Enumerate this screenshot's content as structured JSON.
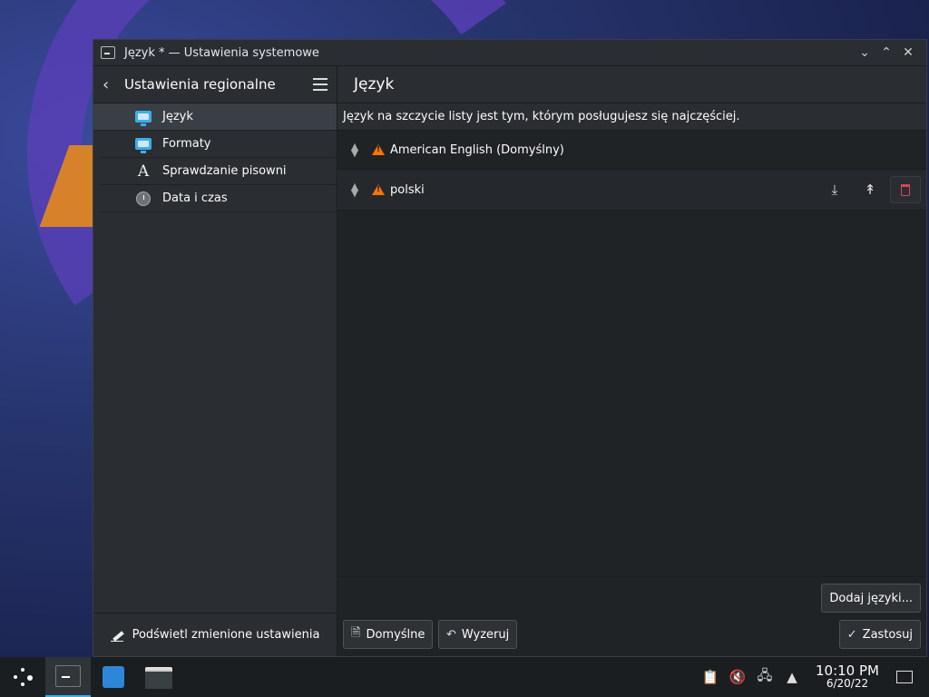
{
  "window": {
    "title": "Język * — Ustawienia systemowe",
    "controls": [
      "minimize",
      "maximize",
      "close"
    ]
  },
  "sidebar": {
    "title": "Ustawienia regionalne",
    "items": [
      {
        "label": "Język",
        "icon": "monitor-flag-icon",
        "active": true
      },
      {
        "label": "Formaty",
        "icon": "monitor-flag-icon",
        "active": false
      },
      {
        "label": "Sprawdzanie pisowni",
        "icon": "letter-a-icon",
        "active": false
      },
      {
        "label": "Data i czas",
        "icon": "clock-icon",
        "active": false
      }
    ],
    "footer_label": "Podświetl zmienione ustawienia"
  },
  "main": {
    "title": "Język",
    "description": "Język na szczycie listy jest tym, którym posługujesz się najczęściej.",
    "languages": [
      {
        "name": "American English (Domyślny)"
      },
      {
        "name": "polski"
      }
    ],
    "buttons": {
      "add": "Dodaj języki...",
      "defaults": "Domyślne",
      "reset": "Wyzeruj",
      "apply": "Zastosuj"
    }
  },
  "taskbar": {
    "time": "10:10 PM",
    "date": "6/20/22"
  },
  "colors": {
    "accent": "#3daee9",
    "warning": "#f67400",
    "delete": "#da4453"
  }
}
